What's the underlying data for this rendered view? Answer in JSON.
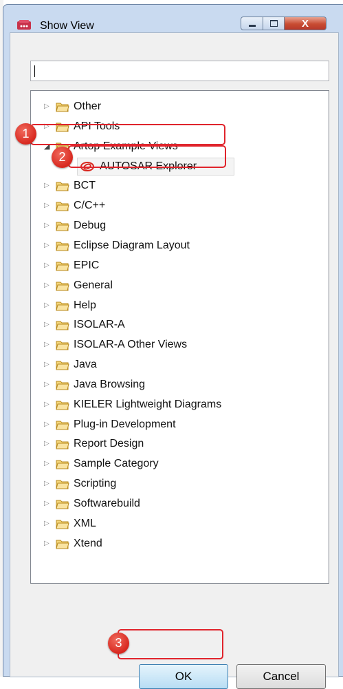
{
  "window": {
    "title": "Show View",
    "minimize_glyph": "—",
    "maximize_glyph": "□",
    "close_glyph": "X"
  },
  "filter": {
    "value": "",
    "placeholder": ""
  },
  "tree": {
    "items": [
      {
        "label": "Other",
        "expanded": false
      },
      {
        "label": "API Tools",
        "expanded": false
      },
      {
        "label": "Artop Example Views",
        "expanded": true
      },
      {
        "label": "AUTOSAR Explorer",
        "child": true
      },
      {
        "label": "BCT",
        "expanded": false
      },
      {
        "label": "C/C++",
        "expanded": false
      },
      {
        "label": "Debug",
        "expanded": false
      },
      {
        "label": "Eclipse Diagram Layout",
        "expanded": false
      },
      {
        "label": "EPIC",
        "expanded": false
      },
      {
        "label": "General",
        "expanded": false
      },
      {
        "label": "Help",
        "expanded": false
      },
      {
        "label": "ISOLAR-A",
        "expanded": false
      },
      {
        "label": "ISOLAR-A Other Views",
        "expanded": false
      },
      {
        "label": "Java",
        "expanded": false
      },
      {
        "label": "Java Browsing",
        "expanded": false
      },
      {
        "label": "KIELER Lightweight Diagrams",
        "expanded": false
      },
      {
        "label": "Plug-in Development",
        "expanded": false
      },
      {
        "label": "Report Design",
        "expanded": false
      },
      {
        "label": "Sample Category",
        "expanded": false
      },
      {
        "label": "Scripting",
        "expanded": false
      },
      {
        "label": "Softwarebuild",
        "expanded": false
      },
      {
        "label": "XML",
        "expanded": false
      },
      {
        "label": "Xtend",
        "expanded": false
      }
    ]
  },
  "annotations": {
    "step1": "1",
    "step2": "2",
    "step3": "3"
  },
  "buttons": {
    "ok": "OK",
    "cancel": "Cancel"
  },
  "colors": {
    "highlight": "#e0242c",
    "folder": "#e8c25c",
    "window_frame": "#c9daf0"
  },
  "icons": {
    "folder": "folder-icon",
    "view": "autosar-explorer-icon",
    "app": "app-icon"
  }
}
